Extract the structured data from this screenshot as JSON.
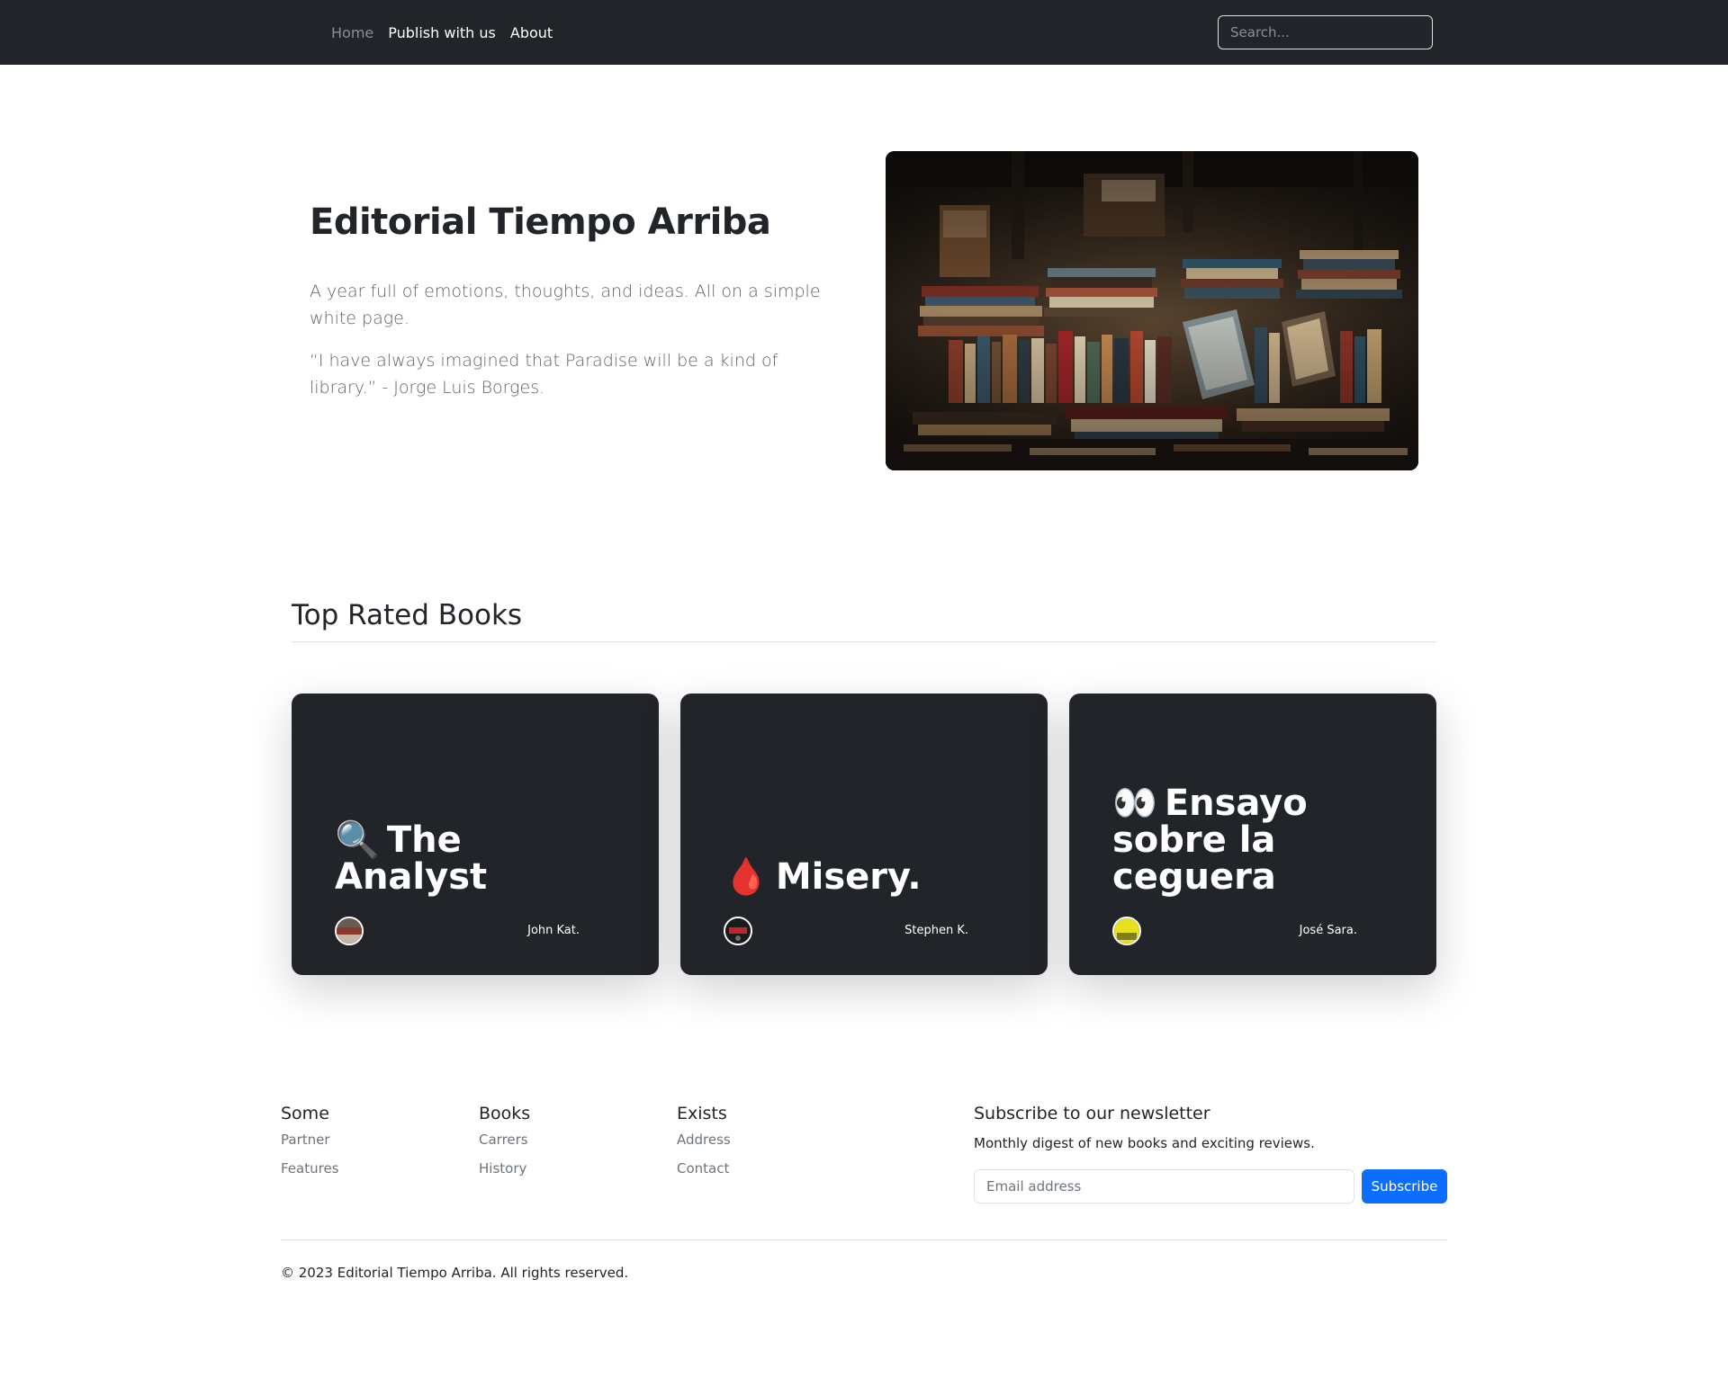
{
  "nav": {
    "items": [
      "Home",
      "Publish with us",
      "About"
    ],
    "search_placeholder": "Search..."
  },
  "hero": {
    "title": "Editorial Tiempo Arriba",
    "paragraph1": "A year full of emotions, thoughts, and ideas. All on a simple white page.",
    "paragraph2": "“I have always imagined that Paradise will be a kind of library.” - Jorge Luis Borges."
  },
  "top_rated": {
    "title": "Top Rated Books",
    "books": [
      {
        "emoji": "🔍",
        "title": "The Analyst",
        "author": "John Kat."
      },
      {
        "emoji": "🩸",
        "title": "Misery.",
        "author": "Stephen K."
      },
      {
        "emoji": "👀",
        "title": "Ensayo sobre la ceguera",
        "author": "José Sara."
      }
    ]
  },
  "footer": {
    "columns": [
      {
        "heading": "Some",
        "links": [
          "Partner",
          "Features"
        ]
      },
      {
        "heading": "Books",
        "links": [
          "Carrers",
          "History"
        ]
      },
      {
        "heading": "Exists",
        "links": [
          "Address",
          "Contact"
        ]
      }
    ],
    "newsletter": {
      "title": "Subscribe to our newsletter",
      "subtitle": "Monthly digest of new books and exciting reviews.",
      "email_placeholder": "Email address",
      "button_label": "Subscribe"
    },
    "copyright": "© 2023 Editorial Tiempo Arriba. All rights reserved."
  },
  "colors": {
    "navbar": "#212529",
    "card": "#212529",
    "primary": "#0d6efd",
    "muted_text": "#6c757d"
  }
}
